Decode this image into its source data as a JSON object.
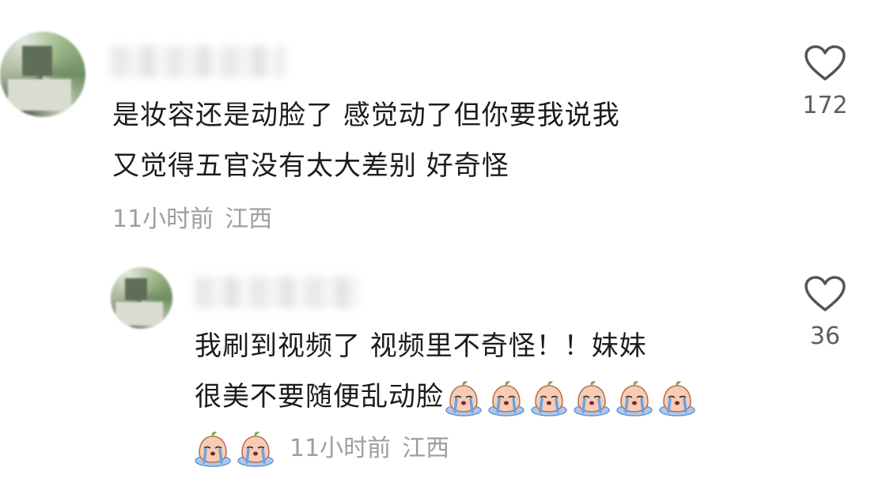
{
  "comments": [
    {
      "text_line1": "是妆容还是动脸了 感觉动了但你要我说我",
      "text_line2": "又觉得五官没有太大差别 好奇怪",
      "time": "11小时前",
      "location": "江西",
      "likes": "172",
      "icons": {
        "like": "heart-outline-icon",
        "avatar": "blurred-avatar"
      }
    },
    {
      "text_line1": "我刷到视频了 视频里不奇怪！！妹妹",
      "text_line2": "很美不要随便乱动脸",
      "emoji_count_line2": 6,
      "emoji_count_line3": 2,
      "emoji": "crying-emoji",
      "time": "11小时前",
      "location": "江西",
      "likes": "36",
      "icons": {
        "like": "heart-outline-icon",
        "avatar": "blurred-avatar"
      }
    }
  ],
  "colors": {
    "text": "#1c1c1c",
    "meta": "#9e9e9e",
    "like_count": "#5e5e5e",
    "heart": "#555555"
  }
}
